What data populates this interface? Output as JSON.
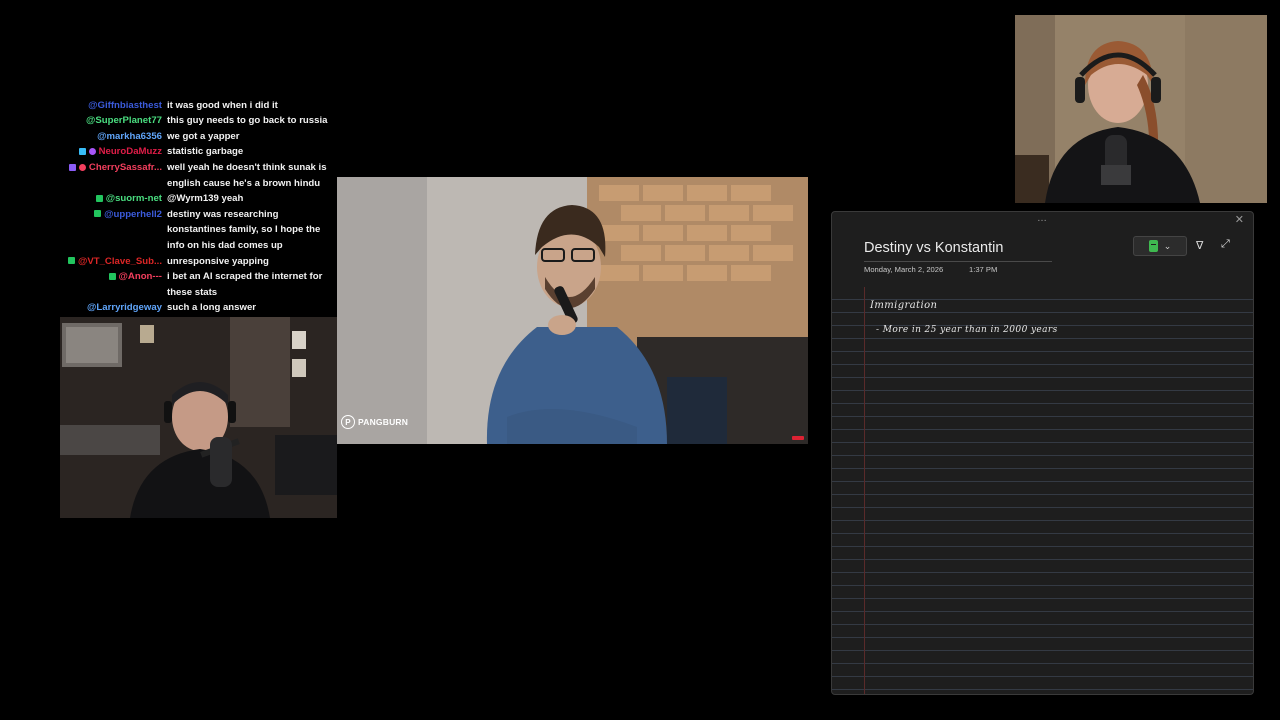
{
  "chat": {
    "messages": [
      {
        "user": "@Giffnbiasthest",
        "user_color": "#3b5bdb",
        "text": "it was good when i did it",
        "badges": []
      },
      {
        "user": "@SuperPlanet77",
        "user_color": "#4ade80",
        "text": "this guy needs to go back to russia",
        "badges": []
      },
      {
        "user": "@markha6356",
        "user_color": "#60a5fa",
        "text": "we got a yapper",
        "badges": []
      },
      {
        "user": "NeuroDaMuzz",
        "user_color": "#e11d48",
        "text": "statistic garbage",
        "badges": [
          "#38bdf8",
          "#a855f7"
        ]
      },
      {
        "user": "CherrySassafr...",
        "user_color": "#f43f5e",
        "text": "well yeah he doesn't think sunak is english cause he's a brown hindu",
        "badges": [
          "#8b5cf6",
          "#f43f5e"
        ]
      },
      {
        "user": "@suorm-net",
        "user_color": "#4ade80",
        "text": "@Wyrm139 yeah",
        "badges": [
          "#22c55e"
        ]
      },
      {
        "user": "@upperhell2",
        "user_color": "#3b5bdb",
        "text": "destiny was researching konstantines family, so I hope the info on his dad comes up",
        "badges": [
          "#22c55e"
        ]
      },
      {
        "user": "@VT_Clave_Sub...",
        "user_color": "#dc2626",
        "text": "unresponsive yapping",
        "badges": [
          "#22c55e"
        ]
      },
      {
        "user": "@Anon---",
        "user_color": "#f43f5e",
        "text": "i bet an AI scraped the internet for these stats",
        "badges": [
          "#22c55e"
        ]
      },
      {
        "user": "@Larryridgeway",
        "user_color": "#60a5fa",
        "text": "such a long answer",
        "badges": []
      }
    ]
  },
  "video": {
    "channel_logo_text": "PANGBURN",
    "logo_glyph": "P"
  },
  "notes": {
    "title": "Destiny vs Konstantin",
    "date": "Monday, March 2, 2026",
    "time": "1:37 PM",
    "handwriting": [
      "Immigration",
      "- More in 25 year than in 2000 years"
    ],
    "toolbar": {
      "pen_color": "#3fb950",
      "grip_glyph": "…",
      "close_glyph": "✕",
      "chevron_glyph": "⌄",
      "filter_glyph": "∇",
      "expand_glyph": "⤢"
    }
  }
}
